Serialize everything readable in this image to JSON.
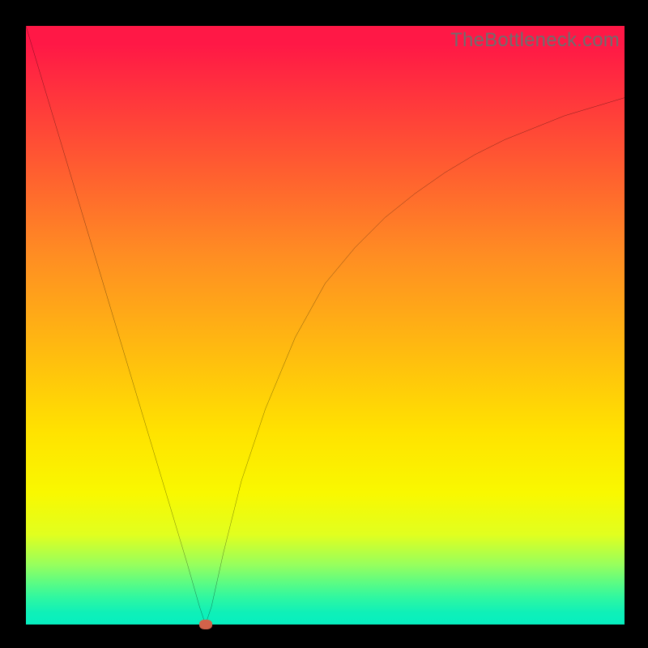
{
  "watermark": "TheBottleneck.com",
  "chart_data": {
    "type": "line",
    "title": "",
    "xlabel": "",
    "ylabel": "",
    "xlim": [
      0,
      100
    ],
    "ylim": [
      0,
      100
    ],
    "series": [
      {
        "name": "bottleneck-curve",
        "x": [
          0,
          3,
          6,
          9,
          12,
          15,
          18,
          21,
          24,
          27,
          29,
          30,
          31,
          33,
          36,
          40,
          45,
          50,
          55,
          60,
          65,
          70,
          75,
          80,
          85,
          90,
          95,
          100
        ],
        "y": [
          100,
          90,
          80,
          70,
          60,
          50,
          40,
          30,
          20,
          10,
          3,
          0,
          3,
          12,
          24,
          36,
          48,
          57,
          63,
          68,
          72,
          75.5,
          78.5,
          81,
          83,
          85,
          86.5,
          88
        ]
      }
    ],
    "optimal_marker": {
      "x": 30,
      "y": 0
    },
    "background_gradient": {
      "top": "#ff1846",
      "bottom": "#06efc0"
    }
  }
}
